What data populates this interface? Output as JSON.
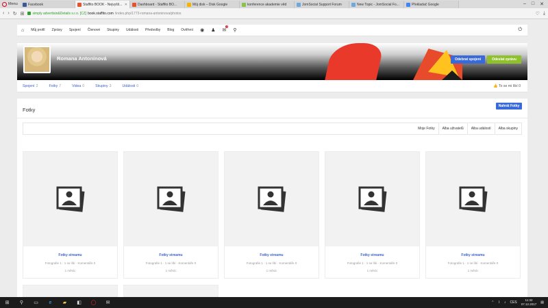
{
  "browser": {
    "menu_label": "Menu",
    "tabs": [
      {
        "label": "Facebook",
        "color": "#3b5998",
        "active": false
      },
      {
        "label": "Staffito BOOK - Nejvyšš...",
        "color": "#e3532d",
        "active": true
      },
      {
        "label": "Dashboard - Staffito BO...",
        "color": "#e3532d",
        "active": false
      },
      {
        "label": "Můj disk – Disk Google",
        "color": "#f4b400",
        "active": false
      },
      {
        "label": "konference akademie věd",
        "color": "#8bc34a",
        "active": false
      },
      {
        "label": "JomSocial Support Forum",
        "color": "#6fa8dc",
        "active": false
      },
      {
        "label": "New Topic - JomSocial Fo...",
        "color": "#6fa8dc",
        "active": false
      },
      {
        "label": "Překladač Google",
        "color": "#4285f4",
        "active": false
      }
    ],
    "url": {
      "org": "simply advertisin&Details s.r.o. [CZ]",
      "host": "book.staffito.com",
      "path": "/index.php/1773-romana-antoninova/photos"
    }
  },
  "nav": {
    "items": [
      "Můj profil",
      "Zprávy",
      "Spojení",
      "Členové",
      "Skupiny",
      "Události",
      "Předvolby",
      "Blog",
      "Ověření"
    ],
    "notif_badge": "1"
  },
  "profile": {
    "name": "Romana Antonínová",
    "unfollow_label": "Odebrat spojení",
    "message_label": "Odeslat zprávu"
  },
  "ptabs": [
    {
      "label": "Spojení",
      "count": "2"
    },
    {
      "label": "Fotky",
      "count": "7"
    },
    {
      "label": "Videa",
      "count": "0"
    },
    {
      "label": "Skupiny",
      "count": "3"
    },
    {
      "label": "Události",
      "count": "0"
    }
  ],
  "like_label": "To se mi líbí",
  "like_count": "0",
  "panel": {
    "title": "Fotky",
    "upload_label": "Nahrát Fotky",
    "filters": [
      "Moje Fotky",
      "Alba uživatelů",
      "Alba událostí",
      "Alba skupiny"
    ]
  },
  "albums": [
    {
      "title": "Fotky streamu",
      "meta": "Fotografie 1 · 1 se líbí · Komentáře 0",
      "date": "1 měsíc"
    },
    {
      "title": "Fotky streamu",
      "meta": "Fotografie 1 · 1 se líbí · Komentáře 0",
      "date": "1 měsíc"
    },
    {
      "title": "Fotky streamu",
      "meta": "Fotografie 1 · 1 se líbí · Komentáře 0",
      "date": "1 měsíc"
    },
    {
      "title": "Fotky streamu",
      "meta": "Fotografie 1 · 1 se líbí · Komentáře 0",
      "date": "1 měsíc"
    },
    {
      "title": "Fotky streamu",
      "meta": "Fotografie 1 · 1 se líbí · Komentáře 0",
      "date": "1 měsíc"
    }
  ],
  "taskbar": {
    "lang": "CES",
    "time": "11:32",
    "date": "07.12.2017"
  }
}
